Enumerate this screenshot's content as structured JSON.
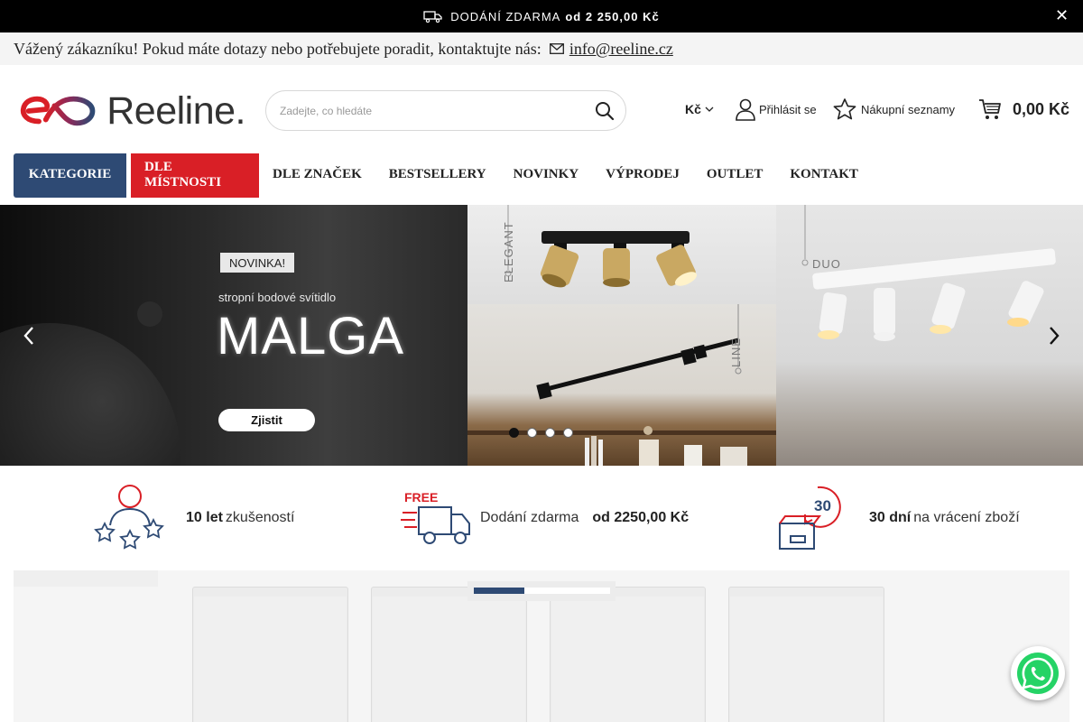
{
  "topbar": {
    "lead": "DODÁNÍ ZDARMA",
    "amount": "od 2 250,00 Kč",
    "close_glyph": "✕"
  },
  "contact": {
    "text": "Vážený zákazníku! Pokud máte dotazy nebo potřebujete poradit, kontaktujte nás:",
    "email": "info@reeline.cz"
  },
  "header": {
    "logo_text": "Reeline.",
    "search_placeholder": "Zadejte, co hledáte",
    "currency": "Kč",
    "login": "Přihlásit se",
    "lists": "Nákupní seznamy",
    "cart_total": "0,00 Kč"
  },
  "nav": {
    "items": [
      "KATEGORIE",
      "DLE MÍSTNOSTI",
      "DLE ZNAČEK",
      "BESTSELLERY",
      "NOVINKY",
      "VÝPRODEJ",
      "OUTLET",
      "KONTAKT"
    ]
  },
  "banner": {
    "badge": "NOVINKA!",
    "subtitle": "stropní bodové svítidlo",
    "title": "MALGA",
    "cta": "Zjistit",
    "label_elegant": "ELEGANT",
    "label_line": "LINE",
    "label_duo": "DUO",
    "slide_count": 4,
    "active_slide": 1
  },
  "benefits": {
    "exp_bold": "10 let",
    "exp_text": "zkušeností",
    "free_label": "FREE",
    "ship_text": "Dodání zdarma",
    "ship_bold": "od 2250,00 Kč",
    "return_number": "30",
    "return_bold": "30 dní",
    "return_text": "na vrácení zboží"
  },
  "scroll_progress": 0.37,
  "colors": {
    "primary": "#2e4a74",
    "accent": "#d91f26",
    "topbar": "#000000",
    "whatsapp": "#25d366"
  }
}
